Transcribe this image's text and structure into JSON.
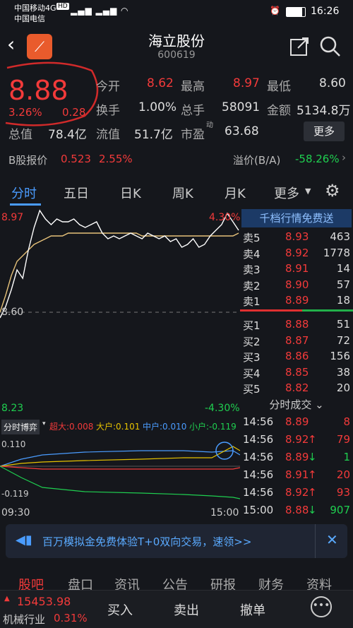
{
  "status": {
    "carrier1": "中国移动4G",
    "hd": "HD",
    "carrier2": "中国电信",
    "time": "16:26"
  },
  "header": {
    "title": "海立股份",
    "code": "600619"
  },
  "quote": {
    "price": "8.88",
    "pct": "3.26%",
    "chg": "0.28",
    "labels": {
      "open": "今开",
      "high": "最高",
      "low": "最低",
      "turnover": "换手",
      "volume": "总手",
      "amount": "金额",
      "mktcap": "总值",
      "float": "流值",
      "pe": "市盈",
      "pe_sup": "动"
    },
    "values": {
      "open": "8.62",
      "high": "8.97",
      "low": "8.60",
      "turnover": "1.00%",
      "volume": "58091",
      "amount": "5134.8万",
      "mktcap": "78.4亿",
      "float": "51.7亿",
      "pe": "63.68"
    },
    "more": "更多"
  },
  "bshare": {
    "label": "B股报价",
    "price": "0.523",
    "pct": "2.55%",
    "premium_label": "溢价(B/A)",
    "premium": "-58.26%"
  },
  "tabs": [
    "分时",
    "五日",
    "日K",
    "周K",
    "月K",
    "更多"
  ],
  "chart": {
    "top_price": "8.97",
    "top_pct": "4.30%",
    "mid_price": "8.60",
    "bot_price": "8.23",
    "bot_pct": "-4.30%"
  },
  "chart_data": {
    "type": "line",
    "series": [],
    "price": [
      8.58,
      8.62,
      8.68,
      8.75,
      8.72,
      8.82,
      8.9,
      8.96,
      8.93,
      8.91,
      8.93,
      8.92,
      8.92,
      8.93,
      8.91,
      8.9,
      8.91,
      8.92,
      8.88,
      8.86,
      8.87,
      8.86,
      8.87,
      8.88,
      8.87,
      8.86,
      8.88,
      8.87,
      8.86,
      8.87,
      8.85,
      8.86,
      8.83,
      8.84,
      8.86,
      8.83,
      8.84,
      8.87,
      8.89,
      8.91,
      8.95,
      8.92,
      8.89
    ],
    "avg": [
      8.6,
      8.66,
      8.73,
      8.78,
      8.8,
      8.82,
      8.84,
      8.85,
      8.86,
      8.87,
      8.87,
      8.87,
      8.88,
      8.88,
      8.88,
      8.88,
      8.88,
      8.88,
      8.88,
      8.88,
      8.88,
      8.88,
      8.88,
      8.88,
      8.88,
      8.87,
      8.87,
      8.87,
      8.87,
      8.87,
      8.87,
      8.87,
      8.87,
      8.87,
      8.87,
      8.87,
      8.87,
      8.87,
      8.87,
      8.87,
      8.87,
      8.87,
      8.88
    ],
    "ylim": [
      8.23,
      8.97
    ]
  },
  "book": {
    "free_label": "千档行情免费送",
    "asks": [
      {
        "label": "卖5",
        "price": "8.93",
        "vol": "463"
      },
      {
        "label": "卖4",
        "price": "8.92",
        "vol": "1778"
      },
      {
        "label": "卖3",
        "price": "8.91",
        "vol": "14"
      },
      {
        "label": "卖2",
        "price": "8.90",
        "vol": "57"
      },
      {
        "label": "卖1",
        "price": "8.89",
        "vol": "18"
      }
    ],
    "bids": [
      {
        "label": "买1",
        "price": "8.88",
        "vol": "51"
      },
      {
        "label": "买2",
        "price": "8.87",
        "vol": "72"
      },
      {
        "label": "买3",
        "price": "8.86",
        "vol": "156"
      },
      {
        "label": "买4",
        "price": "8.85",
        "vol": "38"
      },
      {
        "label": "买5",
        "price": "8.82",
        "vol": "20"
      }
    ],
    "trades_label": "分时成交",
    "trades": [
      {
        "t": "14:56",
        "p": "8.89",
        "a": "",
        "v": "8"
      },
      {
        "t": "14:56",
        "p": "8.92",
        "a": "↑",
        "v": "79"
      },
      {
        "t": "14:56",
        "p": "8.89",
        "a": "↓",
        "v": "1"
      },
      {
        "t": "14:56",
        "p": "8.91",
        "a": "↑",
        "v": "20"
      },
      {
        "t": "14:56",
        "p": "8.92",
        "a": "↑",
        "v": "93"
      },
      {
        "t": "15:00",
        "p": "8.88",
        "a": "↓",
        "v": "907"
      }
    ]
  },
  "game": {
    "label": "分时博弈",
    "super": "超大:0.008",
    "big": "大户:0.101",
    "mid": "中户:0.010",
    "small": "小户:-0.119",
    "top": "0.110",
    "bot": "-0.119",
    "t0": "09:30",
    "t1": "15:00"
  },
  "banner": {
    "text": "百万模拟金免费体验T+0双向交易，速领>>"
  },
  "nav2": [
    "股吧",
    "盘口",
    "资讯",
    "公告",
    "研报",
    "财务",
    "资料"
  ],
  "bottom": {
    "index": "15453.98",
    "industry": "机械行业",
    "ind_pct": "0.31%",
    "buy": "买入",
    "sell": "卖出",
    "order": "撤单"
  }
}
